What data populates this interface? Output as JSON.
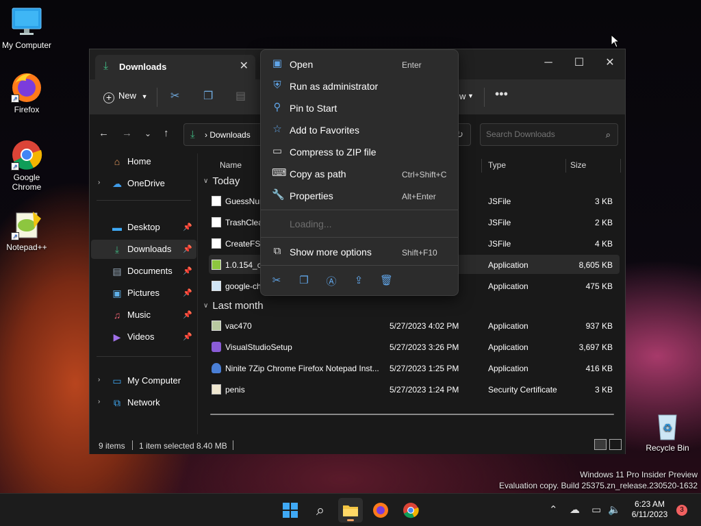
{
  "desktop": {
    "icons": [
      {
        "label": "My Computer"
      },
      {
        "label": "Firefox"
      },
      {
        "label": "Google Chrome"
      },
      {
        "label": "Notepad++"
      },
      {
        "label": "Recycle Bin"
      }
    ]
  },
  "window": {
    "tab_title": "Downloads",
    "toolbar": {
      "new_label": "New"
    },
    "address": {
      "crumb": "Downloads"
    },
    "search": {
      "placeholder": "Search Downloads"
    }
  },
  "nav": {
    "items": [
      {
        "label": "Home"
      },
      {
        "label": "OneDrive"
      },
      {
        "label": "Desktop"
      },
      {
        "label": "Downloads"
      },
      {
        "label": "Documents"
      },
      {
        "label": "Pictures"
      },
      {
        "label": "Music"
      },
      {
        "label": "Videos"
      },
      {
        "label": "My Computer"
      },
      {
        "label": "Network"
      }
    ]
  },
  "columns": {
    "name": "Name",
    "type": "Type",
    "size": "Size"
  },
  "groups": {
    "today": "Today",
    "last_month": "Last month"
  },
  "files": [
    {
      "name": "GuessNur",
      "date": "",
      "type": "JSFile",
      "size": "3 KB"
    },
    {
      "name": "TrashClean",
      "date": "",
      "type": "JSFile",
      "size": "2 KB"
    },
    {
      "name": "CreateFS.j",
      "date": "",
      "type": "JSFile",
      "size": "4 KB"
    },
    {
      "name": "1.0.154_ch",
      "date": "",
      "type": "Application",
      "size": "8,605 KB"
    },
    {
      "name": "google-ch",
      "date": "",
      "type": "Application",
      "size": "475 KB"
    },
    {
      "name": "vac470",
      "date": "5/27/2023 4:02 PM",
      "type": "Application",
      "size": "937 KB"
    },
    {
      "name": "VisualStudioSetup",
      "date": "5/27/2023 3:26 PM",
      "type": "Application",
      "size": "3,697 KB"
    },
    {
      "name": "Ninite 7Zip Chrome Firefox Notepad Inst...",
      "date": "5/27/2023 1:25 PM",
      "type": "Application",
      "size": "416 KB"
    },
    {
      "name": "penis",
      "date": "5/27/2023 1:24 PM",
      "type": "Security Certificate",
      "size": "3 KB"
    }
  ],
  "status": {
    "count": "9 items",
    "selection": "1 item selected  8.40 MB"
  },
  "context_menu": {
    "items": [
      {
        "label": "Open",
        "shortcut": "Enter"
      },
      {
        "label": "Run as administrator",
        "shortcut": ""
      },
      {
        "label": "Pin to Start",
        "shortcut": ""
      },
      {
        "label": "Add to Favorites",
        "shortcut": ""
      },
      {
        "label": "Compress to ZIP file",
        "shortcut": ""
      },
      {
        "label": "Copy as path",
        "shortcut": "Ctrl+Shift+C"
      },
      {
        "label": "Properties",
        "shortcut": "Alt+Enter"
      }
    ],
    "loading": "Loading...",
    "more": {
      "label": "Show more options",
      "shortcut": "Shift+F10"
    },
    "partial_toolbar_text": "w"
  },
  "watermark": {
    "line1": "Windows 11 Pro Insider Preview",
    "line2": "Evaluation copy. Build 25375.zn_release.230520-1632"
  },
  "taskbar": {
    "time": "6:23 AM",
    "date": "6/11/2023",
    "notifications": "3"
  },
  "colors": {
    "accent_green": "#3fb37f",
    "icon_blue": "#60a5e8",
    "badge_red": "#f16060"
  }
}
